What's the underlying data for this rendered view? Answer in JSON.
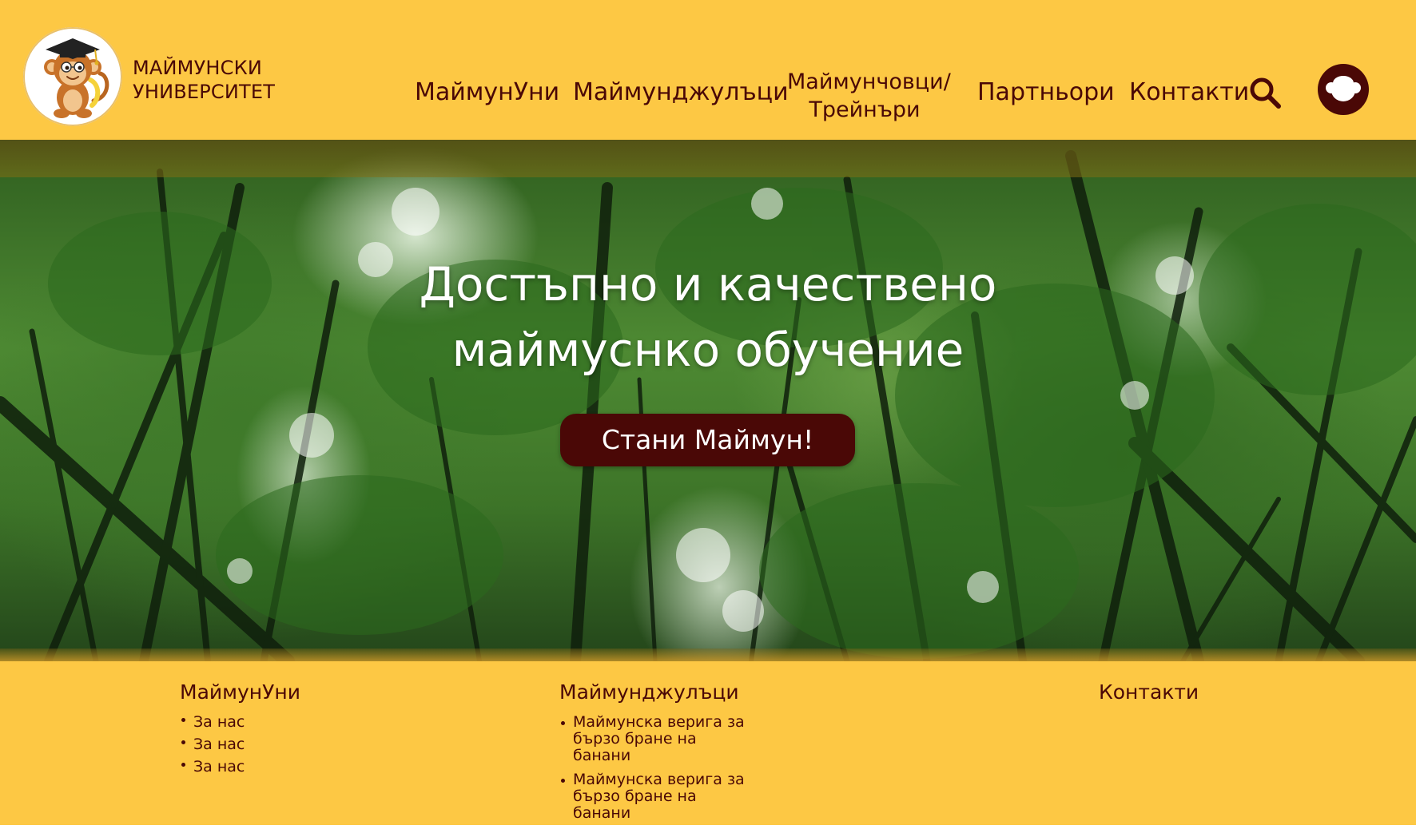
{
  "brand": {
    "name_line1": "МАЙМУНСКИ",
    "name_line2": "УНИВЕРСИТЕТ",
    "logo_icon": "monkey-graduate-icon"
  },
  "nav": {
    "items": [
      {
        "label": "МаймунУни"
      },
      {
        "label": "Маймунджулъци"
      },
      {
        "label_line1": "Маймунчовци/",
        "label_line2": "Трейнъри"
      },
      {
        "label": "Партньори"
      },
      {
        "label": "Контакти"
      }
    ],
    "search_icon": "search-icon",
    "profile_icon": "monkey-face-icon"
  },
  "hero": {
    "title_line1": "Достъпно и качествено",
    "title_line2": "маймуснко обучение",
    "cta_label": "Стани Маймун!"
  },
  "footer": {
    "columns": [
      {
        "heading": "МаймунУни",
        "links": [
          "За нас",
          "За нас",
          "За нас"
        ]
      },
      {
        "heading": "Маймунджулъци",
        "links": [
          {
            "line1": "Маймунска верига за",
            "line2": "бързо бране на банани"
          },
          {
            "line1": "Маймунска верига за",
            "line2": "бързо бране на банани"
          }
        ]
      },
      {
        "heading": "Контакти"
      }
    ]
  },
  "colors": {
    "primary_yellow": "#fdc844",
    "dark_maroon": "#4a0806",
    "white": "#ffffff"
  }
}
